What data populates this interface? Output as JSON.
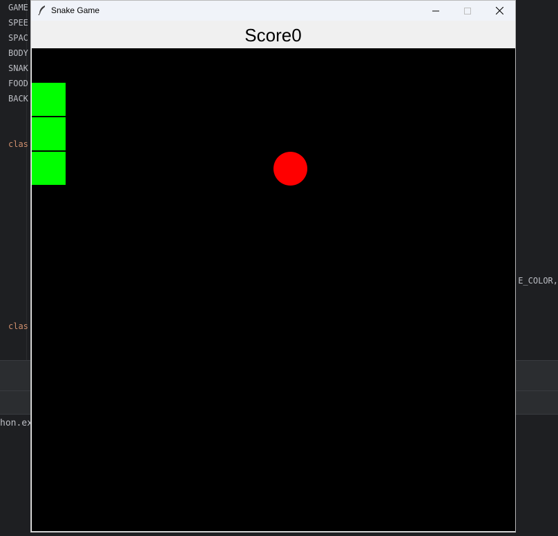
{
  "background_ide": {
    "code_lines": [
      "GAME",
      "SPEE",
      "SPAC",
      "BODY",
      "SNAK",
      "FOOD",
      "BACK",
      "clas",
      "clas"
    ],
    "right_fragment": "E_COLOR,",
    "console_fragment": "hon.ex"
  },
  "window": {
    "title": "Snake Game",
    "icon": "feather-icon",
    "minimize_icon": "minimize-icon",
    "maximize_icon": "maximize-icon",
    "close_icon": "close-icon"
  },
  "game": {
    "score_text": "Score0",
    "canvas_color": "#000000",
    "snake_color": "#00FF00",
    "food_color": "#FF0000",
    "snake_segments": 3
  }
}
